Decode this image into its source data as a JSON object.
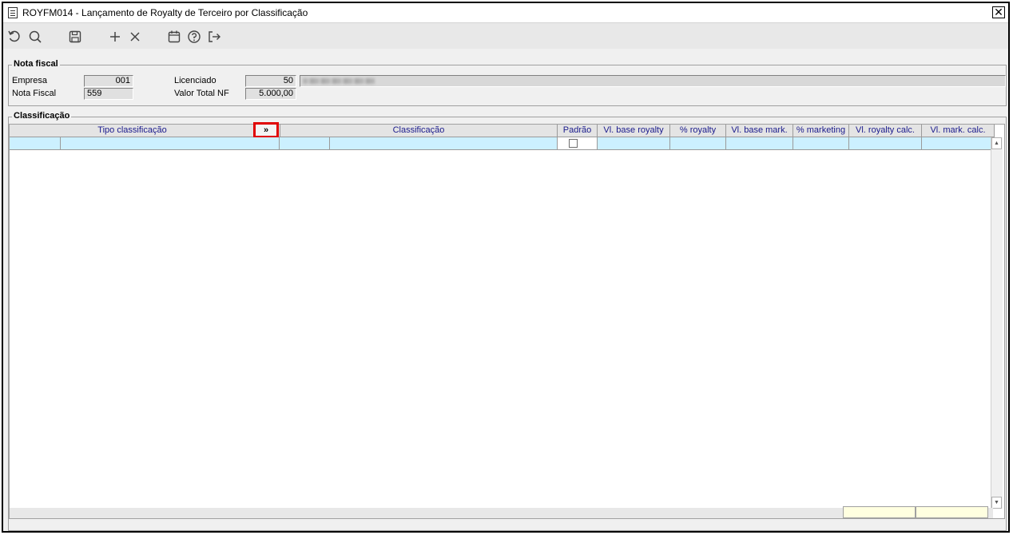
{
  "window": {
    "title": "ROYFM014 - Lançamento de Royalty de Terceiro por Classificação",
    "close_glyph": "✕"
  },
  "toolbar": {
    "icons": [
      "undo-icon",
      "search-icon",
      "save-icon",
      "add-icon",
      "delete-icon",
      "calendar-icon",
      "help-icon",
      "exit-icon"
    ]
  },
  "nota_fiscal": {
    "legend": "Nota fiscal",
    "empresa_label": "Empresa",
    "empresa_value": "001",
    "nota_fiscal_label": "Nota Fiscal",
    "nota_fiscal_value": "559",
    "licenciado_label": "Licenciado",
    "licenciado_value": "50",
    "valor_total_label": "Valor Total NF",
    "valor_total_value": "5.000,00"
  },
  "classificacao": {
    "legend": "Classificação",
    "expand_label": "»",
    "columns": {
      "tipo": "Tipo classificação",
      "classificacao": "Classificação",
      "padrao": "Padrão",
      "vl_base_royalty": "Vl. base royalty",
      "pct_royalty": "% royalty",
      "vl_base_mark": "Vl. base mark.",
      "pct_marketing": "% marketing",
      "vl_royalty_calc": "Vl. royalty calc.",
      "vl_mark_calc": "Vl. mark. calc."
    }
  },
  "colors": {
    "selected_row": "#ccf0ff",
    "header_text": "#1a1a8c",
    "highlight": "#e00000",
    "totals": "#ffffe0"
  }
}
